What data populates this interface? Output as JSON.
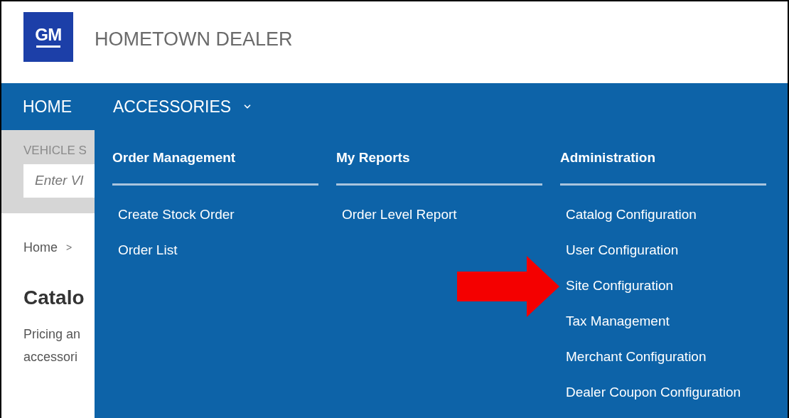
{
  "header": {
    "logo_text": "GM",
    "title": "HOMETOWN DEALER"
  },
  "nav": [
    {
      "label": "HOME",
      "expanded": false
    },
    {
      "label": "ACCESSORIES",
      "expanded": true
    }
  ],
  "page": {
    "search_label": "VEHICLE S",
    "search_placeholder": "Enter VI",
    "breadcrumb": [
      "Home",
      ">"
    ],
    "heading": "Catalo",
    "description_lines": [
      "Pricing an",
      "accessori"
    ]
  },
  "dropdown": {
    "columns": [
      {
        "title": "Order Management",
        "items": [
          "Create Stock Order",
          "Order List"
        ]
      },
      {
        "title": "My Reports",
        "items": [
          "Order Level Report"
        ]
      },
      {
        "title": "Administration",
        "items": [
          "Catalog Configuration",
          "User Configuration",
          "Site Configuration",
          "Tax Management",
          "Merchant Configuration",
          "Dealer Coupon Configuration"
        ]
      }
    ]
  }
}
